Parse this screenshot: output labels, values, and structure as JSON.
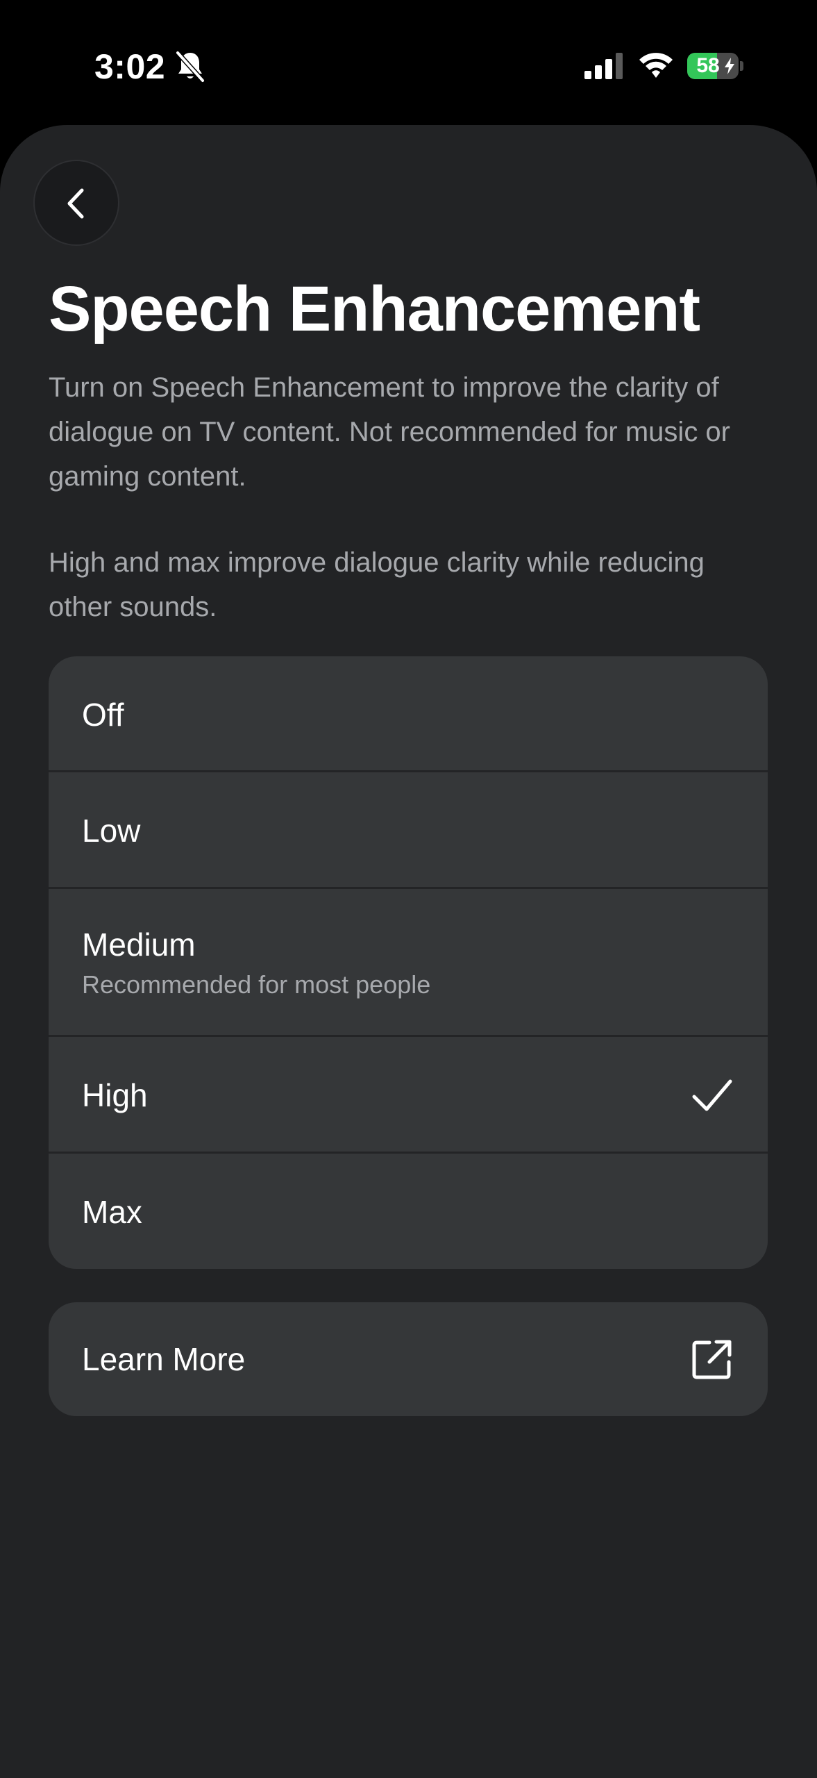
{
  "status_bar": {
    "time": "3:02",
    "battery_level": "58",
    "battery_fraction": 0.58,
    "icons": [
      "bell-slash-icon",
      "cellular-signal-icon",
      "wifi-icon",
      "battery-icon",
      "charging-bolt-icon"
    ]
  },
  "navigation": {
    "back_icon": "chevron-left-icon"
  },
  "page": {
    "title": "Speech Enhancement",
    "description_1": "Turn on Speech Enhancement to improve the clarity of dialogue on TV content. Not recommended for music or gaming content.",
    "description_2": "High and max improve dialogue clarity while reducing other sounds."
  },
  "options": [
    {
      "label": "Off",
      "subtitle": "",
      "selected": false
    },
    {
      "label": "Low",
      "subtitle": "",
      "selected": false
    },
    {
      "label": "Medium",
      "subtitle": "Recommended for most people",
      "selected": false
    },
    {
      "label": "High",
      "subtitle": "",
      "selected": true
    },
    {
      "label": "Max",
      "subtitle": "",
      "selected": false
    }
  ],
  "learn_more": {
    "label": "Learn More",
    "icon": "external-link-icon"
  },
  "colors": {
    "background": "#000000",
    "sheet": "#222325",
    "card": "#353739",
    "secondary_text": "#a7a9ad",
    "battery_green": "#33c659"
  }
}
